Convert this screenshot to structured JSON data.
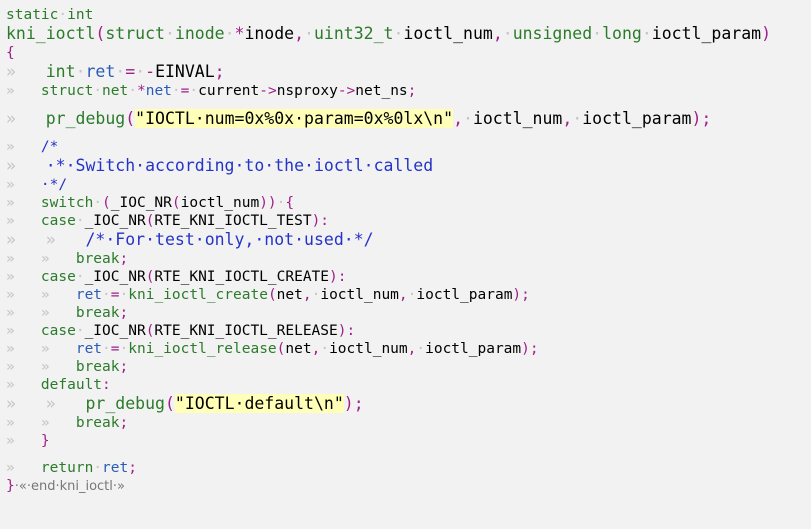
{
  "editor": {
    "lines": [
      {
        "k": "normal",
        "t": [
          [
            "kw",
            "static"
          ],
          [
            "ws",
            "·"
          ],
          [
            "kw",
            "int"
          ]
        ]
      },
      {
        "k": "big",
        "t": [
          [
            "fn",
            "kni_ioctl"
          ],
          [
            "pp",
            "("
          ],
          [
            "ty",
            "struct"
          ],
          [
            "ws",
            "·"
          ],
          [
            "ty",
            "inode"
          ],
          [
            "ws",
            "·"
          ],
          [
            "pp",
            "*"
          ],
          [
            "",
            "inode"
          ],
          [
            "pp",
            ","
          ],
          [
            "ws",
            "·"
          ],
          [
            "ty",
            "uint32_t"
          ],
          [
            "ws",
            "·"
          ],
          [
            "",
            "ioctl_num"
          ],
          [
            "pp",
            ","
          ],
          [
            "ws",
            "·"
          ],
          [
            "ty",
            "unsigned"
          ],
          [
            "ws",
            "·"
          ],
          [
            "ty",
            "long"
          ],
          [
            "ws",
            "·"
          ],
          [
            "",
            "ioctl_param"
          ],
          [
            "pp",
            ")"
          ]
        ]
      },
      {
        "k": "normal",
        "t": [
          [
            "brace",
            "{"
          ]
        ]
      },
      {
        "k": "big",
        "t": [
          [
            "ws",
            "»   "
          ],
          [
            "ty",
            "int"
          ],
          [
            "ws",
            "·"
          ],
          [
            "nm",
            "ret"
          ],
          [
            "ws",
            "·"
          ],
          [
            "op",
            "="
          ],
          [
            "ws",
            "·"
          ],
          [
            "op",
            "-"
          ],
          [
            "",
            "EINVAL"
          ],
          [
            "pp",
            ";"
          ]
        ]
      },
      {
        "k": "normal",
        "t": [
          [
            "ws",
            "»   "
          ],
          [
            "ty",
            "struct"
          ],
          [
            "ws",
            "·"
          ],
          [
            "ty",
            "net"
          ],
          [
            "ws",
            "·"
          ],
          [
            "pp",
            "*"
          ],
          [
            "nm",
            "net"
          ],
          [
            "ws",
            "·"
          ],
          [
            "op",
            "="
          ],
          [
            "ws",
            "·"
          ],
          [
            "",
            "current"
          ],
          [
            "op",
            "->"
          ],
          [
            "",
            "nsproxy"
          ],
          [
            "op",
            "->"
          ],
          [
            "",
            "net_ns"
          ],
          [
            "pp",
            ";"
          ]
        ]
      },
      {
        "k": "sp",
        "t": []
      },
      {
        "k": "big",
        "t": [
          [
            "ws",
            "»   "
          ],
          [
            "fn",
            "pr_debug"
          ],
          [
            "pp",
            "("
          ],
          [
            "str",
            "\"IOCTL·num=0x%0x·param=0x%0lx\\n\""
          ],
          [
            "pp",
            ","
          ],
          [
            "ws",
            "·"
          ],
          [
            "",
            "ioctl_num"
          ],
          [
            "pp",
            ","
          ],
          [
            "ws",
            "·"
          ],
          [
            "",
            "ioctl_param"
          ],
          [
            "pp",
            ");"
          ]
        ]
      },
      {
        "k": "sp",
        "t": []
      },
      {
        "k": "normal",
        "t": [
          [
            "ws",
            "»   "
          ],
          [
            "cm",
            "/*"
          ]
        ]
      },
      {
        "k": "big",
        "t": [
          [
            "ws",
            "»   "
          ],
          [
            "cm",
            "·*·Switch·according·to·the·ioctl·called"
          ]
        ]
      },
      {
        "k": "normal",
        "t": [
          [
            "ws",
            "»   "
          ],
          [
            "cm",
            "·*/"
          ]
        ]
      },
      {
        "k": "normal",
        "t": [
          [
            "ws",
            "»   "
          ],
          [
            "kw",
            "switch"
          ],
          [
            "ws",
            "·"
          ],
          [
            "pp",
            "("
          ],
          [
            "",
            "_IOC_NR"
          ],
          [
            "pp",
            "("
          ],
          [
            "",
            "ioctl_num"
          ],
          [
            "pp",
            "))"
          ],
          [
            "ws",
            "·"
          ],
          [
            "brace",
            "{"
          ]
        ]
      },
      {
        "k": "normal",
        "t": [
          [
            "ws",
            "»   "
          ],
          [
            "kw",
            "case"
          ],
          [
            "ws",
            "·"
          ],
          [
            "",
            "_IOC_NR"
          ],
          [
            "pp",
            "("
          ],
          [
            "",
            "RTE_KNI_IOCTL_TEST"
          ],
          [
            "pp",
            "):"
          ]
        ]
      },
      {
        "k": "big",
        "t": [
          [
            "ws",
            "»   »   "
          ],
          [
            "cm",
            "/*·For·test·only,·not·used·*/"
          ]
        ]
      },
      {
        "k": "normal",
        "t": [
          [
            "ws",
            "»   »   "
          ],
          [
            "kw",
            "break"
          ],
          [
            "pp",
            ";"
          ]
        ]
      },
      {
        "k": "normal",
        "t": [
          [
            "ws",
            "»   "
          ],
          [
            "kw",
            "case"
          ],
          [
            "ws",
            "·"
          ],
          [
            "",
            "_IOC_NR"
          ],
          [
            "pp",
            "("
          ],
          [
            "",
            "RTE_KNI_IOCTL_CREATE"
          ],
          [
            "pp",
            "):"
          ]
        ]
      },
      {
        "k": "normal",
        "t": [
          [
            "ws",
            "»   »   "
          ],
          [
            "nm",
            "ret"
          ],
          [
            "ws",
            "·"
          ],
          [
            "op",
            "="
          ],
          [
            "ws",
            "·"
          ],
          [
            "fn",
            "kni_ioctl_create"
          ],
          [
            "pp",
            "("
          ],
          [
            "",
            "net"
          ],
          [
            "pp",
            ","
          ],
          [
            "ws",
            "·"
          ],
          [
            "",
            "ioctl_num"
          ],
          [
            "pp",
            ","
          ],
          [
            "ws",
            "·"
          ],
          [
            "",
            "ioctl_param"
          ],
          [
            "pp",
            ");"
          ]
        ]
      },
      {
        "k": "normal",
        "t": [
          [
            "ws",
            "»   »   "
          ],
          [
            "kw",
            "break"
          ],
          [
            "pp",
            ";"
          ]
        ]
      },
      {
        "k": "normal",
        "t": [
          [
            "ws",
            "»   "
          ],
          [
            "kw",
            "case"
          ],
          [
            "ws",
            "·"
          ],
          [
            "",
            "_IOC_NR"
          ],
          [
            "pp",
            "("
          ],
          [
            "",
            "RTE_KNI_IOCTL_RELEASE"
          ],
          [
            "pp",
            "):"
          ]
        ]
      },
      {
        "k": "normal",
        "t": [
          [
            "ws",
            "»   »   "
          ],
          [
            "nm",
            "ret"
          ],
          [
            "ws",
            "·"
          ],
          [
            "op",
            "="
          ],
          [
            "ws",
            "·"
          ],
          [
            "fn",
            "kni_ioctl_release"
          ],
          [
            "pp",
            "("
          ],
          [
            "",
            "net"
          ],
          [
            "pp",
            ","
          ],
          [
            "ws",
            "·"
          ],
          [
            "",
            "ioctl_num"
          ],
          [
            "pp",
            ","
          ],
          [
            "ws",
            "·"
          ],
          [
            "",
            "ioctl_param"
          ],
          [
            "pp",
            ");"
          ]
        ]
      },
      {
        "k": "normal",
        "t": [
          [
            "ws",
            "»   »   "
          ],
          [
            "kw",
            "break"
          ],
          [
            "pp",
            ";"
          ]
        ]
      },
      {
        "k": "normal",
        "t": [
          [
            "ws",
            "»   "
          ],
          [
            "kw",
            "default"
          ],
          [
            "pp",
            ":"
          ]
        ]
      },
      {
        "k": "big",
        "t": [
          [
            "ws",
            "»   »   "
          ],
          [
            "fn",
            "pr_debug"
          ],
          [
            "pp",
            "("
          ],
          [
            "str",
            "\"IOCTL·default\\n\""
          ],
          [
            "pp",
            ");"
          ]
        ]
      },
      {
        "k": "normal",
        "t": [
          [
            "ws",
            "»   »   "
          ],
          [
            "kw",
            "break"
          ],
          [
            "pp",
            ";"
          ]
        ]
      },
      {
        "k": "normal",
        "t": [
          [
            "ws",
            "»   "
          ],
          [
            "brace",
            "}"
          ]
        ]
      },
      {
        "k": "sp",
        "t": []
      },
      {
        "k": "normal",
        "t": [
          [
            "ws",
            "»   "
          ],
          [
            "kw",
            "return"
          ],
          [
            "ws",
            "·"
          ],
          [
            "nm",
            "ret"
          ],
          [
            "pp",
            ";"
          ]
        ]
      },
      {
        "k": "normal",
        "t": [
          [
            "brace",
            "}"
          ],
          [
            "fold",
            "·«·end·kni_ioctl·»"
          ]
        ]
      }
    ]
  }
}
